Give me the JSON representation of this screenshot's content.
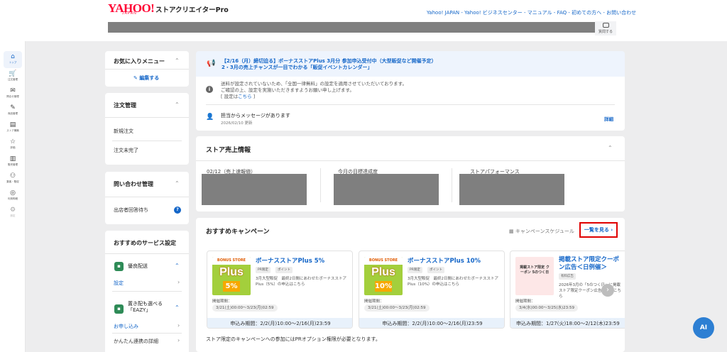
{
  "header": {
    "logo": "YAHOO!",
    "logo_sub": "JAPAN",
    "app_title": "ストアクリエイターPro",
    "links": [
      "Yahoo! JAPAN",
      "Yahoo! ビジネスセンター",
      "マニュアル",
      "FAQ",
      "初めての方へ",
      "お問い合わせ"
    ],
    "link_sep": " - ",
    "chat_label": "質問する"
  },
  "leftnav": [
    {
      "label": "トップ",
      "icon": "home-icon",
      "glyph": "⌂",
      "active": true
    },
    {
      "label": "注文管理",
      "icon": "cart-icon",
      "glyph": "🛒"
    },
    {
      "label": "問合せ管理",
      "icon": "inquiry-icon",
      "glyph": "✉"
    },
    {
      "label": "商品管理",
      "icon": "edit-icon",
      "glyph": "✎"
    },
    {
      "label": "ストア構築",
      "icon": "store-icon",
      "glyph": "▤"
    },
    {
      "label": "評価",
      "icon": "star-icon",
      "glyph": "☆"
    },
    {
      "label": "販売管理",
      "icon": "chart-icon",
      "glyph": "▥"
    },
    {
      "label": "集客・販促",
      "icon": "people-icon",
      "glyph": "⚇"
    },
    {
      "label": "利用明細",
      "icon": "coins-icon",
      "glyph": "◎"
    },
    {
      "label": "設定",
      "icon": "gear-icon",
      "glyph": "⚙"
    }
  ],
  "favorites": {
    "title": "お気に入りメニュー",
    "edit_label": "編集する"
  },
  "orders": {
    "title": "注文管理",
    "items": [
      "新規注文",
      "注文未完了"
    ]
  },
  "inquiries": {
    "title": "問い合わせ管理",
    "item": "出店者回答待ち",
    "badge": "?"
  },
  "services": {
    "title": "おすすめのサービス設定",
    "items": [
      {
        "name": "優良配送",
        "link": "設定"
      },
      {
        "name": "置き配も選べる「EAZY」",
        "link": "お申し込み",
        "sub": "かんたん連携の詳細"
      }
    ]
  },
  "banner": {
    "line1": "【2/16（月）締切迫る】ボーナスストアPlus 3月分 参加申込受付中（大型販促など開催予定）",
    "line2": "2・3月の売上チャンスが一目でわかる「販促イベントカレンダー」"
  },
  "notice": {
    "text1": "送料が設定されていないため、「全国一律無料」の設定を適用させていただいております。",
    "text2": "ご確認の上、設定を実施いただきますようお願い申し上げます。",
    "text3_prefix": "[ 設定は",
    "text3_link": "こちら",
    "text3_suffix": " ]",
    "message_title": "担当からメッセージがあります",
    "message_date": "2026/02/10 更新",
    "detail_label": "詳細"
  },
  "sales": {
    "title": "ストア売上情報",
    "columns": [
      "02/12（売上速報値）",
      "今月の目標達成度",
      "ストアパフォーマンス"
    ]
  },
  "campaigns": {
    "title": "おすすめキャンペーン",
    "schedule_label": "キャンペーンスケジュール",
    "see_all_label": "一覧を見る",
    "period_label": "開催期間：",
    "cards": [
      {
        "title": "ボーナスストアPlus 5%",
        "tags": [
          "PR限定",
          "ポイント"
        ],
        "desc": "3月大型販促　最終2日間にあわせたボーナスストアPlus（5%）の申込はこちら",
        "period": "3/21(土)00:00〜3/23(月)02:59",
        "apply": "申込み期間：2/2(月)10:00〜2/16(月)23:59",
        "thumb_strip": "BONUS STORE",
        "thumb_main": "Plus",
        "thumb_pct": "5%"
      },
      {
        "title": "ボーナスストアPlus 10%",
        "tags": [
          "PR限定",
          "ポイント"
        ],
        "desc": "3月大型販促　最終2日間にあわせたボーナスストアPlus（10%）の申込はこちら",
        "period": "3/21(土)00:00〜3/23(月)02:59",
        "apply": "申込み期間：2/2(月)10:00〜2/16(月)23:59",
        "thumb_strip": "BONUS STORE",
        "thumb_main": "Plus",
        "thumb_pct": "10%"
      },
      {
        "title": "掲載ストア限定クーポン広告＜日例催＞",
        "tags": [
          "有料広告"
        ],
        "desc": "2026年3月の「5のつく日」に掲載ストア限定クーポン広告申込はこちら",
        "period": "3/4(水)00:00〜3/25(水)23:59",
        "apply": "申込み期間：1/27(火)18:00〜2/12(木)23:59",
        "thumb_text": "掲載ストア限定 クーポン 5のつく日"
      }
    ],
    "footnote": "ストア限定のキャンペーンへの参加にはPRオプション権限が必要となります。"
  },
  "ai_button": "AI"
}
